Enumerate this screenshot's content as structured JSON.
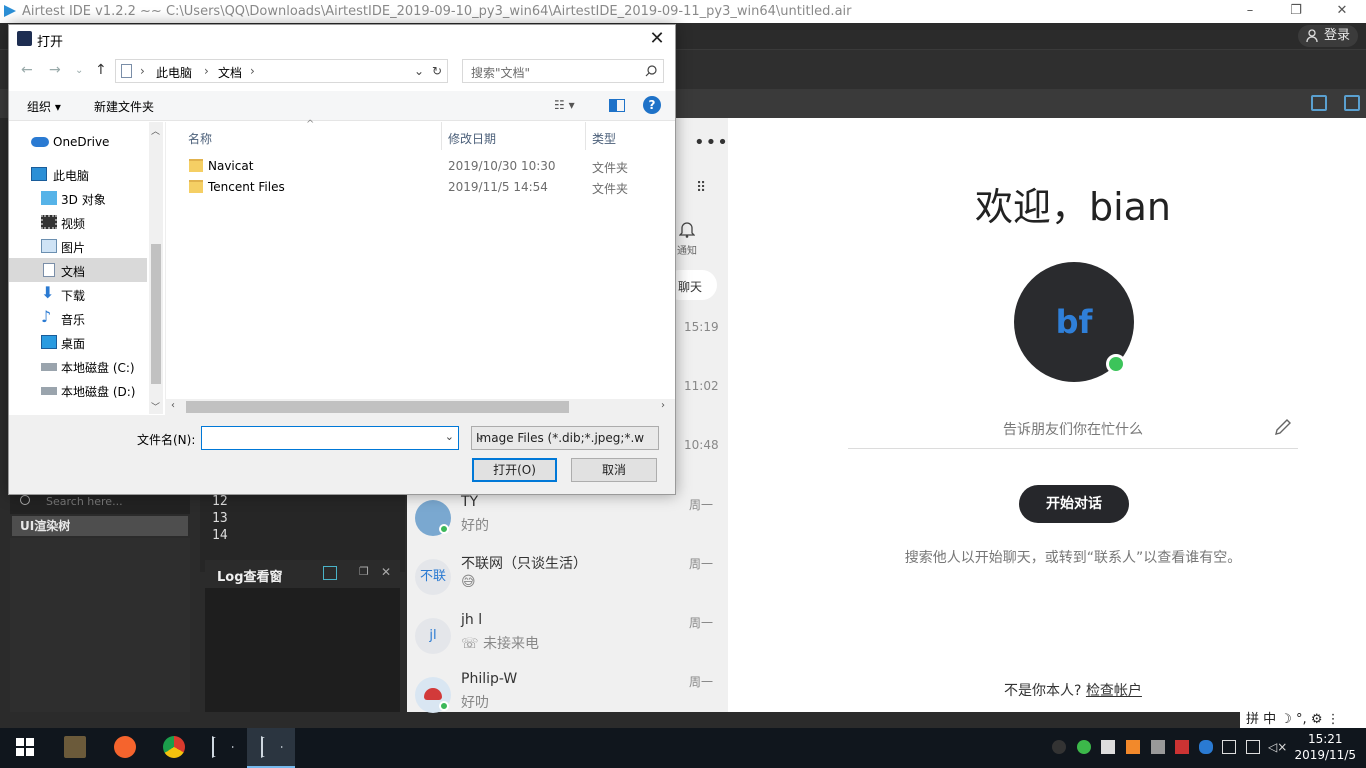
{
  "airtest": {
    "window_title": "Airtest IDE v1.2.2 ~~ C:\\Users\\QQ\\Downloads\\AirtestIDE_2019-09-10_py3_win64\\AirtestIDE_2019-09-11_py3_win64\\untitled.air",
    "login_label": "登录",
    "search_placeholder": "Search here...",
    "ui_tree_tab": "UI渲染树",
    "line_numbers": [
      "12",
      "13",
      "14"
    ],
    "log_title": "Log查看窗"
  },
  "chat": {
    "top_times": [
      "15:19",
      "11:02",
      "10:48"
    ],
    "notify_label": "通知",
    "chat_tab": "聊天",
    "items": [
      {
        "name": "TY",
        "msg": "好的",
        "time": "周一",
        "avatar": ""
      },
      {
        "name": "不联网（只谈生活）",
        "msg": "😅",
        "time": "周一",
        "avatar": "不联"
      },
      {
        "name": "jh l",
        "msg": "未接来电",
        "time": "周一",
        "avatar": "jl"
      },
      {
        "name": "Philip-W",
        "msg": "好叻",
        "time": "周一",
        "avatar": ""
      }
    ]
  },
  "welcome": {
    "title": "欢迎，bian",
    "avatar_initials": "bf",
    "status_placeholder": "告诉朋友们你在忙什么",
    "start_button": "开始对话",
    "hint": "搜索他人以开始聊天，或转到“联系人”以查看谁有空。",
    "not_you": "不是你本人?",
    "check_account": "检查帐户"
  },
  "dialog": {
    "title": "打开",
    "breadcrumb": [
      "此电脑",
      "文档"
    ],
    "search_placeholder": "搜索\"文档\"",
    "organize": "组织 ▾",
    "new_folder": "新建文件夹",
    "nav": [
      {
        "label": "OneDrive",
        "icon": "cloud-icon"
      },
      {
        "label": "此电脑",
        "icon": "computer-icon"
      },
      {
        "label": "3D 对象",
        "icon": "cube-icon"
      },
      {
        "label": "视频",
        "icon": "video-icon"
      },
      {
        "label": "图片",
        "icon": "picture-icon"
      },
      {
        "label": "文档",
        "icon": "document-icon",
        "selected": true
      },
      {
        "label": "下载",
        "icon": "download-icon"
      },
      {
        "label": "音乐",
        "icon": "music-icon"
      },
      {
        "label": "桌面",
        "icon": "desktop-icon"
      },
      {
        "label": "本地磁盘 (C:)",
        "icon": "drive-icon"
      },
      {
        "label": "本地磁盘 (D:)",
        "icon": "drive-icon"
      }
    ],
    "columns": {
      "name": "名称",
      "date": "修改日期",
      "type": "类型"
    },
    "files": [
      {
        "name": "Navicat",
        "date": "2019/10/30 10:30",
        "type": "文件夹"
      },
      {
        "name": "Tencent Files",
        "date": "2019/11/5 14:54",
        "type": "文件夹"
      }
    ],
    "filename_label": "文件名(N):",
    "filename_value": "",
    "filetype_value": "Image Files (*.dib;*.jpeg;*.we",
    "open_button": "打开(O)",
    "cancel_button": "取消"
  },
  "ime": {
    "text": "拼 中 ☽ °, ⚙ ⋮"
  },
  "taskbar": {
    "time": "15:21",
    "date": "2019/11/5"
  }
}
